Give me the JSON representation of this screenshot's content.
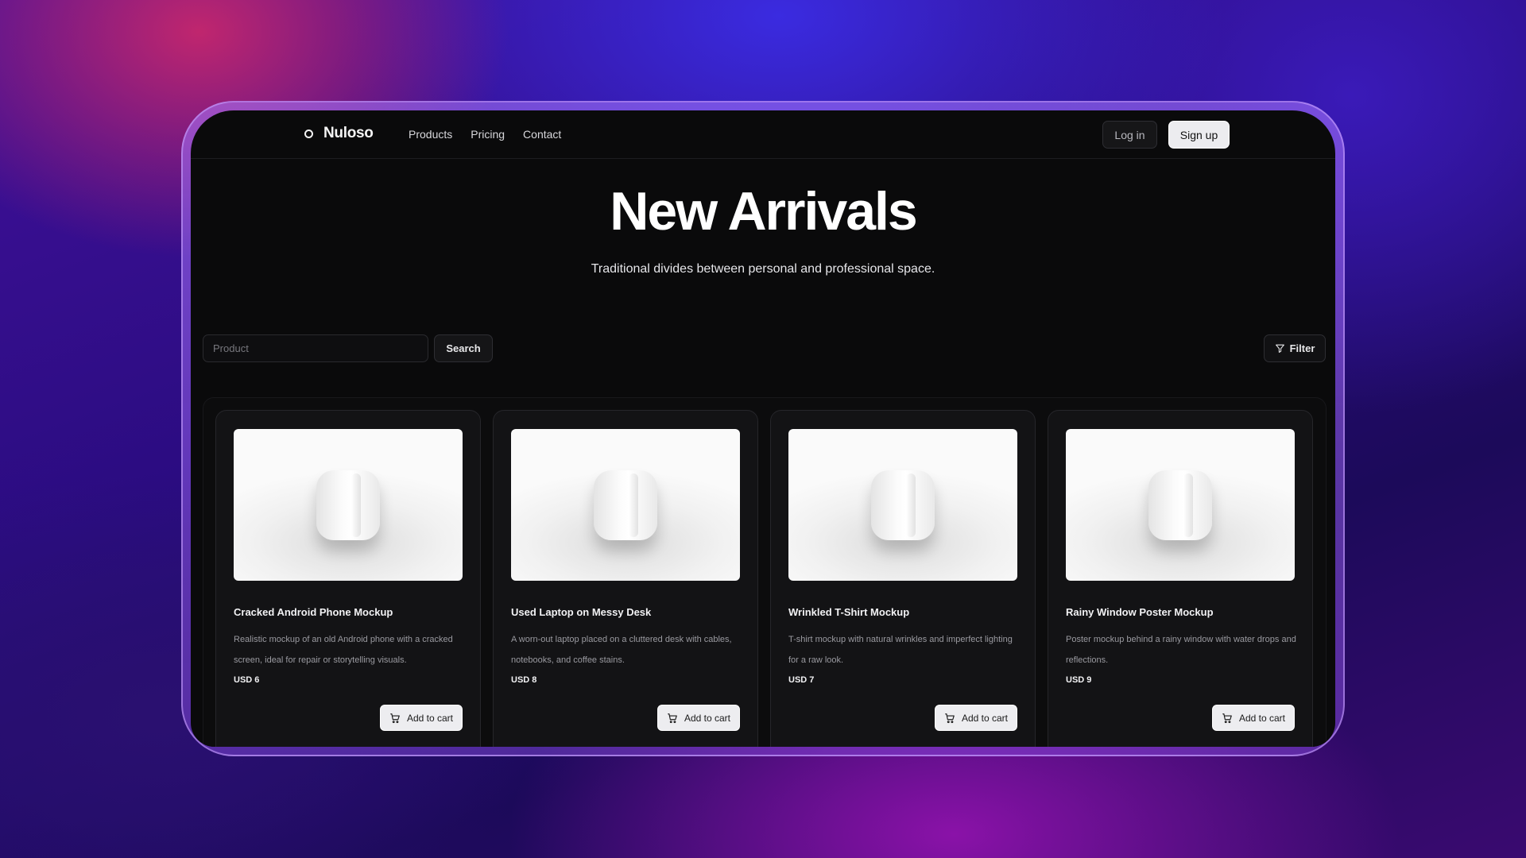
{
  "brand": {
    "name": "Nuloso"
  },
  "nav": {
    "links": [
      "Products",
      "Pricing",
      "Contact"
    ],
    "login_label": "Log in",
    "signup_label": "Sign up"
  },
  "hero": {
    "title": "New Arrivals",
    "subtitle": "Traditional divides between personal and professional space."
  },
  "search": {
    "placeholder": "Product",
    "button_label": "Search",
    "filter_label": "Filter"
  },
  "products": [
    {
      "title": "Cracked Android Phone Mockup",
      "description": "Realistic mockup of an old Android phone with a cracked screen, ideal for repair or storytelling visuals.",
      "price": "USD 6",
      "cart_label": "Add to cart"
    },
    {
      "title": "Used Laptop on Messy Desk",
      "description": "A worn-out laptop placed on a cluttered desk with cables, notebooks, and coffee stains.",
      "price": "USD 8",
      "cart_label": "Add to cart"
    },
    {
      "title": "Wrinkled T-Shirt Mockup",
      "description": "T-shirt mockup with natural wrinkles and imperfect lighting for a raw look.",
      "price": "USD 7",
      "cart_label": "Add to cart"
    },
    {
      "title": "Rainy Window Poster Mockup",
      "description": "Poster mockup behind a rainy window with water drops and reflections.",
      "price": "USD 9",
      "cart_label": "Add to cart"
    }
  ],
  "icons": {
    "logo": "circle-logo-icon",
    "filter": "filter-funnel-icon",
    "cart": "shopping-cart-icon"
  },
  "colors": {
    "background": "#0a0a0b",
    "frame_accent": "#a878ff",
    "button_light": "#ececef"
  }
}
